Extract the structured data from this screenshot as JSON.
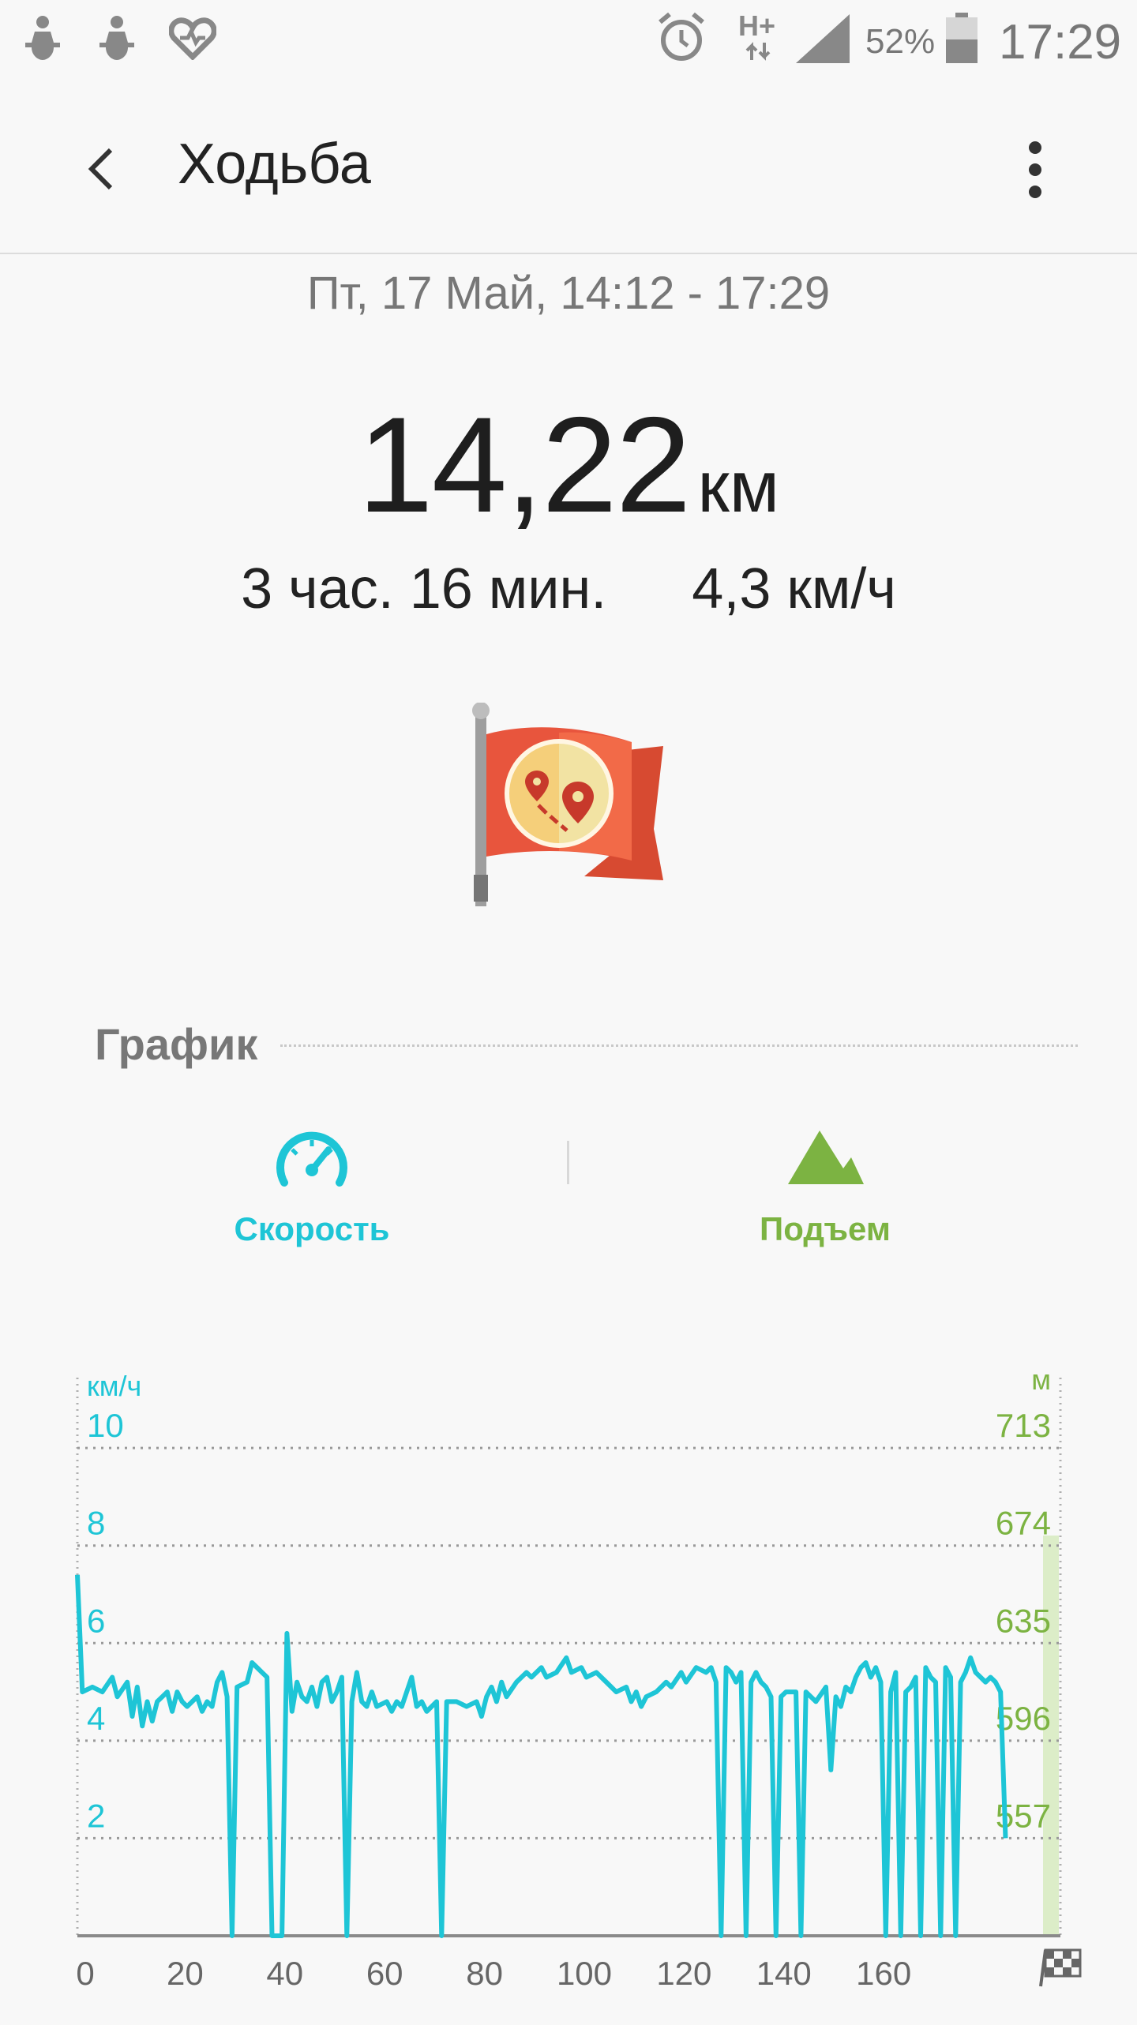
{
  "status_bar": {
    "network_type": "H+",
    "battery_percent": "52%",
    "time": "17:29",
    "icons": [
      "notification-figure-icon",
      "notification-figure-icon",
      "heart-rate-icon",
      "alarm-icon",
      "signal-icon",
      "battery-icon"
    ]
  },
  "app_bar": {
    "title": "Ходьба"
  },
  "workout": {
    "datetime": "Пт, 17 Май, 14:12 - 17:29",
    "distance_value": "14,22",
    "distance_unit": "км",
    "duration": "3 час. 16 мин.",
    "avg_speed": "4,3 км/ч"
  },
  "colors": {
    "speed": "#1ec5d6",
    "elevation": "#7cb342",
    "flag": "#e8553d"
  },
  "chart_section": {
    "title": "График",
    "tabs": [
      {
        "label": "Скорость",
        "icon": "speedometer-icon"
      },
      {
        "label": "Подъем",
        "icon": "mountain-icon"
      }
    ]
  },
  "chart_data": {
    "type": "line",
    "left_axis_unit": "км/ч",
    "right_axis_unit": "м",
    "left_ticks": [
      "10",
      "8",
      "6",
      "4",
      "2"
    ],
    "right_ticks": [
      "713",
      "674",
      "635",
      "596",
      "557"
    ],
    "x_ticks": [
      "0",
      "20",
      "40",
      "60",
      "80",
      "100",
      "120",
      "140",
      "160"
    ],
    "xlim": [
      0,
      197
    ],
    "ylim": [
      0,
      11.2
    ],
    "grid": true,
    "series": [
      {
        "values": [
          [
            0,
            7.4
          ],
          [
            1,
            5.0
          ],
          [
            3,
            5.1
          ],
          [
            5,
            5.0
          ],
          [
            7,
            5.3
          ],
          [
            8,
            4.9
          ],
          [
            10,
            5.2
          ],
          [
            11,
            4.5
          ],
          [
            12,
            5.1
          ],
          [
            13,
            4.3
          ],
          [
            14,
            4.8
          ],
          [
            15,
            4.4
          ],
          [
            16,
            4.8
          ],
          [
            18,
            5.0
          ],
          [
            19,
            4.6
          ],
          [
            20,
            5.0
          ],
          [
            21,
            4.8
          ],
          [
            22,
            4.7
          ],
          [
            24,
            4.9
          ],
          [
            25,
            4.6
          ],
          [
            26,
            4.8
          ],
          [
            27,
            4.7
          ],
          [
            28,
            5.2
          ],
          [
            29,
            5.4
          ],
          [
            30,
            4.9
          ],
          [
            31,
            0
          ],
          [
            32,
            5.1
          ],
          [
            34,
            5.2
          ],
          [
            35,
            5.6
          ],
          [
            36,
            5.5
          ],
          [
            37,
            5.4
          ],
          [
            38,
            5.3
          ],
          [
            39,
            0
          ],
          [
            40,
            0
          ],
          [
            41,
            0
          ],
          [
            42,
            6.2
          ],
          [
            43,
            4.6
          ],
          [
            44,
            5.2
          ],
          [
            45,
            4.9
          ],
          [
            46,
            4.8
          ],
          [
            47,
            5.1
          ],
          [
            48,
            4.7
          ],
          [
            49,
            5.2
          ],
          [
            50,
            5.3
          ],
          [
            51,
            4.8
          ],
          [
            52,
            5.0
          ],
          [
            53,
            5.3
          ],
          [
            54,
            0
          ],
          [
            55,
            4.8
          ],
          [
            56,
            5.4
          ],
          [
            57,
            4.8
          ],
          [
            58,
            4.7
          ],
          [
            59,
            5.0
          ],
          [
            60,
            4.7
          ],
          [
            62,
            4.8
          ],
          [
            63,
            4.6
          ],
          [
            64,
            4.8
          ],
          [
            65,
            4.7
          ],
          [
            67,
            5.3
          ],
          [
            68,
            4.7
          ],
          [
            69,
            4.8
          ],
          [
            70,
            4.6
          ],
          [
            72,
            4.8
          ],
          [
            73,
            0
          ],
          [
            74,
            4.8
          ],
          [
            76,
            4.8
          ],
          [
            78,
            4.7
          ],
          [
            80,
            4.8
          ],
          [
            81,
            4.5
          ],
          [
            82,
            4.9
          ],
          [
            83,
            5.1
          ],
          [
            84,
            4.8
          ],
          [
            85,
            5.2
          ],
          [
            86,
            4.9
          ],
          [
            88,
            5.2
          ],
          [
            90,
            5.4
          ],
          [
            91,
            5.3
          ],
          [
            93,
            5.5
          ],
          [
            94,
            5.3
          ],
          [
            96,
            5.4
          ],
          [
            98,
            5.7
          ],
          [
            99,
            5.4
          ],
          [
            101,
            5.5
          ],
          [
            102,
            5.3
          ],
          [
            104,
            5.4
          ],
          [
            106,
            5.2
          ],
          [
            108,
            5.0
          ],
          [
            110,
            5.1
          ],
          [
            111,
            4.8
          ],
          [
            112,
            5.0
          ],
          [
            113,
            4.7
          ],
          [
            114,
            4.9
          ],
          [
            116,
            5.0
          ],
          [
            118,
            5.2
          ],
          [
            119,
            5.1
          ],
          [
            121,
            5.4
          ],
          [
            122,
            5.2
          ],
          [
            124,
            5.5
          ],
          [
            126,
            5.4
          ],
          [
            127,
            5.5
          ],
          [
            128,
            5.2
          ],
          [
            129,
            0
          ],
          [
            130,
            5.5
          ],
          [
            131,
            5.4
          ],
          [
            132,
            5.2
          ],
          [
            133,
            5.4
          ],
          [
            134,
            0
          ],
          [
            135,
            5.2
          ],
          [
            136,
            5.4
          ],
          [
            137,
            5.2
          ],
          [
            138,
            5.1
          ],
          [
            139,
            4.9
          ],
          [
            140,
            0
          ],
          [
            141,
            4.9
          ],
          [
            142,
            5.0
          ],
          [
            144,
            5.0
          ],
          [
            145,
            0
          ],
          [
            146,
            5.0
          ],
          [
            148,
            4.8
          ],
          [
            150,
            5.1
          ],
          [
            151,
            3.4
          ],
          [
            152,
            4.9
          ],
          [
            153,
            4.7
          ],
          [
            154,
            5.1
          ],
          [
            155,
            5.0
          ],
          [
            156,
            5.3
          ],
          [
            157,
            5.5
          ],
          [
            158,
            5.6
          ],
          [
            159,
            5.3
          ],
          [
            160,
            5.5
          ],
          [
            161,
            5.2
          ],
          [
            162,
            0
          ],
          [
            163,
            5.0
          ],
          [
            164,
            5.4
          ],
          [
            165,
            0
          ],
          [
            166,
            5.0
          ],
          [
            167,
            5.1
          ],
          [
            168,
            5.3
          ],
          [
            169,
            0
          ],
          [
            170,
            5.5
          ],
          [
            171,
            5.3
          ],
          [
            172,
            5.2
          ],
          [
            173,
            0
          ],
          [
            174,
            5.5
          ],
          [
            175,
            5.3
          ],
          [
            176,
            0
          ],
          [
            177,
            5.2
          ],
          [
            178,
            5.4
          ],
          [
            179,
            5.7
          ],
          [
            180,
            5.4
          ],
          [
            181,
            5.3
          ],
          [
            182,
            5.2
          ],
          [
            183,
            5.3
          ],
          [
            184,
            5.2
          ],
          [
            185,
            5.0
          ],
          [
            186,
            2.0
          ]
        ]
      }
    ]
  }
}
